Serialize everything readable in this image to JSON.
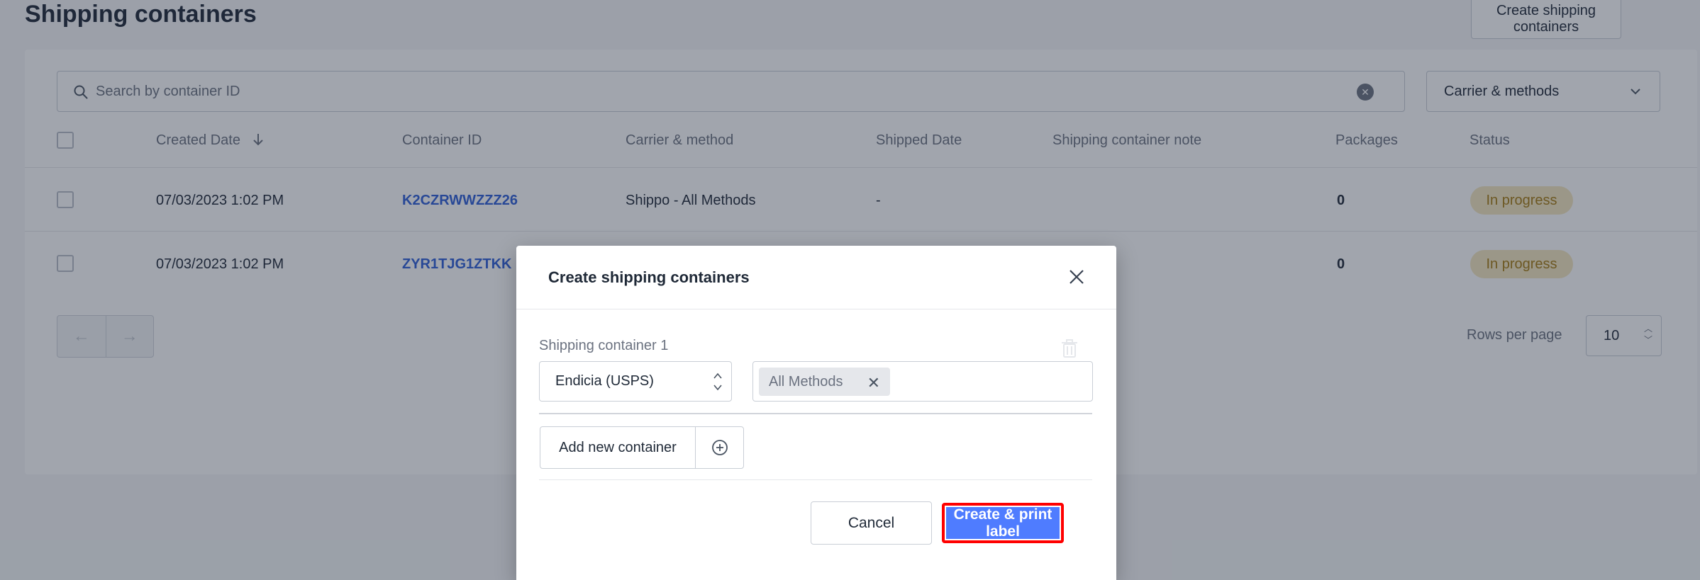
{
  "page": {
    "title": "Shipping containers",
    "header_button": "Create shipping containers"
  },
  "search": {
    "placeholder": "Search by container ID"
  },
  "filter": {
    "label": "Carrier & methods"
  },
  "table": {
    "headers": {
      "created_date": "Created Date",
      "container_id": "Container ID",
      "carrier_method": "Carrier & method",
      "shipped_date": "Shipped Date",
      "note": "Shipping container note",
      "packages": "Packages",
      "status": "Status"
    },
    "rows": [
      {
        "created_date": "07/03/2023 1:02 PM",
        "container_id": "K2CZRWWZZZ26",
        "carrier_method": "Shippo - All Methods",
        "shipped_date": "-",
        "note": "",
        "packages": "0",
        "status": "In progress"
      },
      {
        "created_date": "07/03/2023 1:02 PM",
        "container_id": "ZYR1TJG1ZTKK",
        "carrier_method": "",
        "shipped_date": "",
        "note": "",
        "packages": "0",
        "status": "In progress"
      }
    ]
  },
  "pagination": {
    "rows_per_page_label": "Rows per page",
    "rows_per_page_value": "10"
  },
  "modal": {
    "title": "Create shipping containers",
    "container_label": "Shipping container 1",
    "carrier_value": "Endicia (USPS)",
    "method_chip": "All Methods",
    "add_container_label": "Add new container",
    "cancel_label": "Cancel",
    "primary_label": "Create & print label"
  },
  "colors": {
    "link": "#2f5fd8",
    "primary": "#4f7cff",
    "highlight": "#ff0000",
    "badge_bg": "#f4e7bf",
    "badge_text": "#a67b12"
  },
  "icons": [
    "search-icon",
    "clear-icon",
    "chevron-down-icon",
    "sort-down-icon",
    "arrow-left-icon",
    "arrow-right-icon",
    "close-icon",
    "trash-icon",
    "updown-icon",
    "plus-circle-icon"
  ]
}
